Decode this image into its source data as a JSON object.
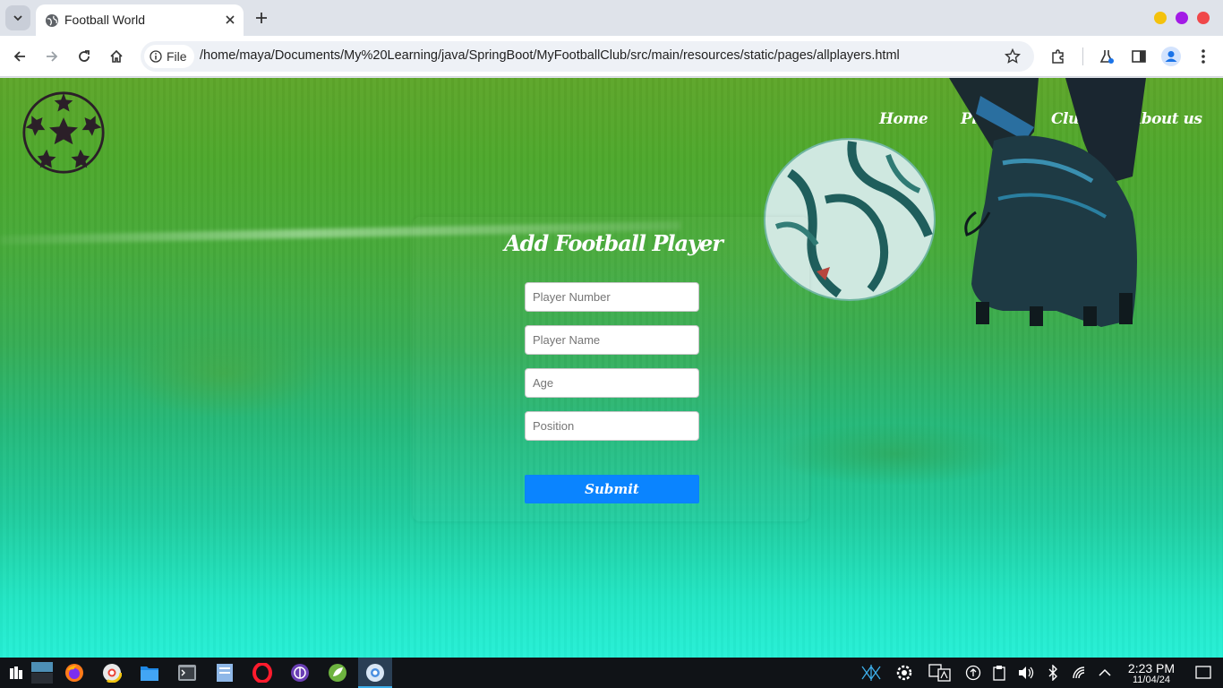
{
  "browser": {
    "tab_title": "Football World",
    "file_label": "File",
    "url": "/home/maya/Documents/My%20Learning/java/SpringBoot/MyFootballClub/src/main/resources/static/pages/allplayers.html"
  },
  "nav": {
    "items": [
      {
        "label": "Home"
      },
      {
        "label": "Players"
      },
      {
        "label": "Clubs"
      },
      {
        "label": "About us"
      }
    ]
  },
  "form": {
    "title": "Add Football Player",
    "fields": [
      {
        "placeholder": "Player Number",
        "value": ""
      },
      {
        "placeholder": "Player Name",
        "value": ""
      },
      {
        "placeholder": "Age",
        "value": ""
      },
      {
        "placeholder": "Position",
        "value": ""
      }
    ],
    "submit_label": "Submit"
  },
  "taskbar": {
    "time": "2:23 PM",
    "date": "11/04/24",
    "apps": [
      "app-launcher-icon",
      "desktop-pager-icon",
      "firefox-icon",
      "chrome-icon",
      "files-icon",
      "terminal-icon",
      "text-editor-icon",
      "opera-icon",
      "tor-icon",
      "springtool-icon",
      "chromium-icon"
    ]
  },
  "colors": {
    "accent": "#0a84ff",
    "grass_top": "#5ea62a",
    "grass_bottom": "#26f0d6"
  }
}
